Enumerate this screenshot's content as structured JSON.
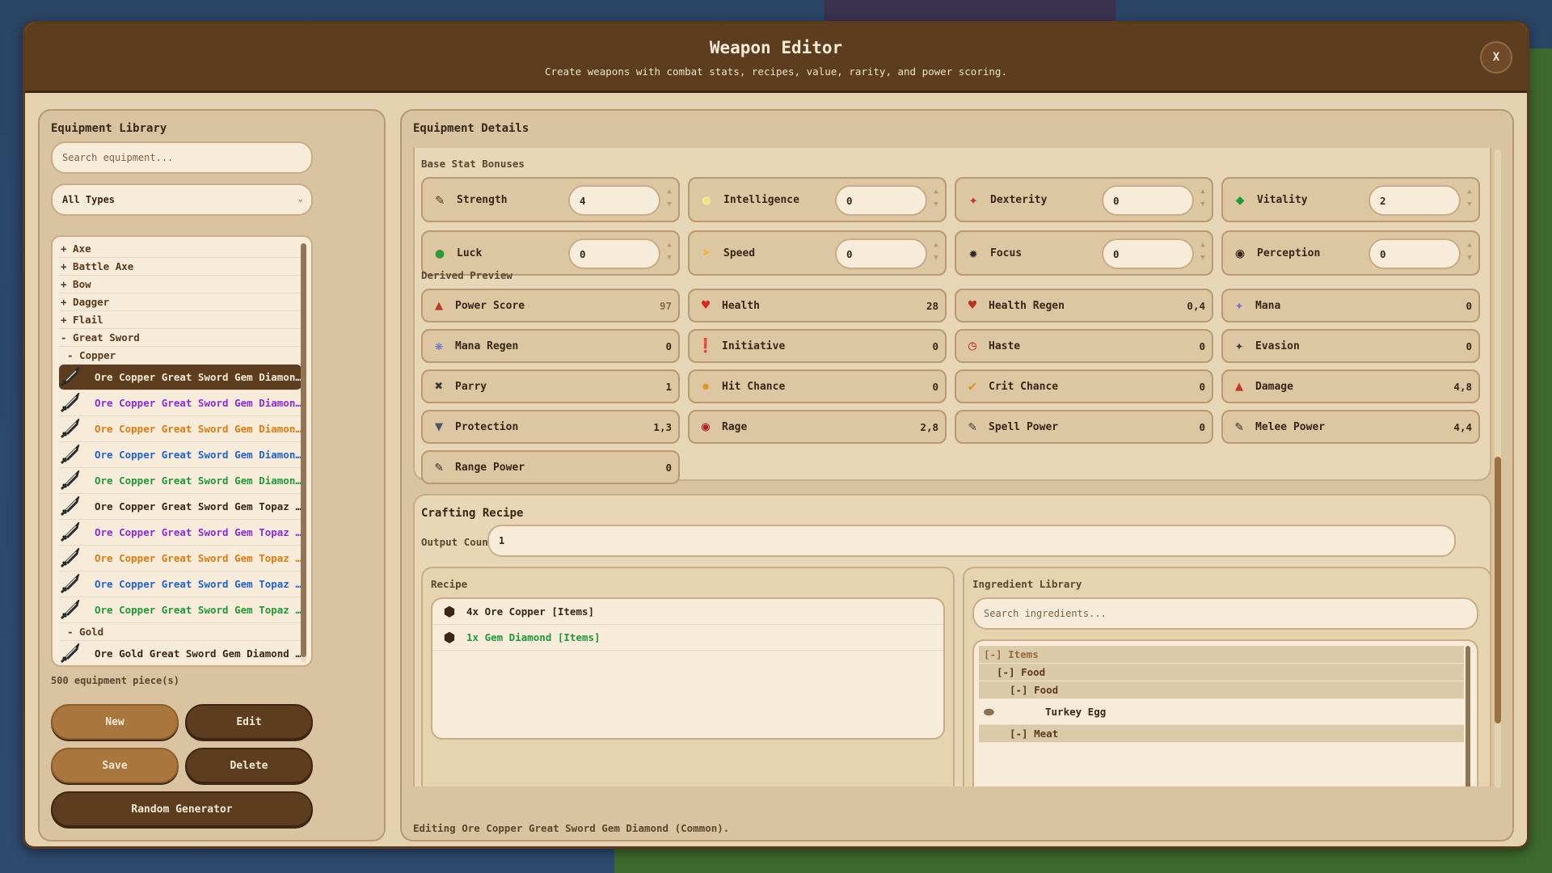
{
  "window": {
    "title": "Weapon Editor",
    "subtitle": "Create weapons with combat stats, recipes, value, rarity, and power scoring.",
    "close_label": "X"
  },
  "library": {
    "title": "Equipment Library",
    "search_placeholder": "Search equipment...",
    "type_filter": "All Types",
    "categories": [
      "+ Axe",
      "+ Battle Axe",
      "+ Bow",
      "+ Dagger",
      "+ Flail",
      "- Great Sword"
    ],
    "subgroup_copper": "- Copper",
    "items": [
      {
        "label": "Ore Copper Great Sword Gem Diamond (Commo...",
        "rarity": "common",
        "selected": true
      },
      {
        "label": "Ore Copper Great Sword Gem Diamond (Epic)  [...",
        "rarity": "epic"
      },
      {
        "label": "Ore Copper Great Sword Gem Diamond (Legend...",
        "rarity": "legend"
      },
      {
        "label": "Ore Copper Great Sword Gem Diamond (Rare)  ...",
        "rarity": "rare"
      },
      {
        "label": "Ore Copper Great Sword Gem Diamond (Uncom...",
        "rarity": "uncom"
      },
      {
        "label": "Ore Copper Great Sword Gem Topaz (Common) ...",
        "rarity": "common"
      },
      {
        "label": "Ore Copper Great Sword Gem Topaz (Epic)  [Epi...",
        "rarity": "epic"
      },
      {
        "label": "Ore Copper Great Sword Gem Topaz (Legendar...",
        "rarity": "legend"
      },
      {
        "label": "Ore Copper Great Sword Gem Topaz (Rare)  [R...",
        "rarity": "rare"
      },
      {
        "label": "Ore Copper Great Sword Gem Topaz (Uncommo...",
        "rarity": "uncom"
      }
    ],
    "subgroup_gold": "- Gold",
    "gold_item": "Ore Gold Great Sword Gem Diamond (Common)  ...",
    "count": "500 equipment piece(s)",
    "buttons": {
      "new": "New",
      "edit": "Edit",
      "save": "Save",
      "delete": "Delete",
      "random": "Random Generator"
    }
  },
  "details": {
    "title": "Equipment Details",
    "base_label": "Base Stat Bonuses",
    "base_stats": [
      {
        "name": "Strength",
        "value": "4",
        "icon": "strength-icon"
      },
      {
        "name": "Intelligence",
        "value": "0",
        "icon": "intelligence-icon"
      },
      {
        "name": "Dexterity",
        "value": "0",
        "icon": "dexterity-icon"
      },
      {
        "name": "Vitality",
        "value": "2",
        "icon": "vitality-icon"
      },
      {
        "name": "Luck",
        "value": "0",
        "icon": "luck-icon"
      },
      {
        "name": "Speed",
        "value": "0",
        "icon": "speed-icon"
      },
      {
        "name": "Focus",
        "value": "0",
        "icon": "focus-icon"
      },
      {
        "name": "Perception",
        "value": "0",
        "icon": "perception-icon"
      }
    ],
    "derived_label": "Derived Preview",
    "derived": [
      {
        "name": "Power Score",
        "value": "97",
        "icon": "power-score-icon"
      },
      {
        "name": "Health",
        "value": "28",
        "icon": "health-icon"
      },
      {
        "name": "Health Regen",
        "value": "0,4",
        "icon": "health-regen-icon"
      },
      {
        "name": "Mana",
        "value": "0",
        "icon": "mana-icon"
      },
      {
        "name": "Mana Regen",
        "value": "0",
        "icon": "mana-regen-icon"
      },
      {
        "name": "Initiative",
        "value": "0",
        "icon": "initiative-icon"
      },
      {
        "name": "Haste",
        "value": "0",
        "icon": "haste-icon"
      },
      {
        "name": "Evasion",
        "value": "0",
        "icon": "evasion-icon"
      },
      {
        "name": "Parry",
        "value": "1",
        "icon": "parry-icon"
      },
      {
        "name": "Hit Chance",
        "value": "0",
        "icon": "hit-chance-icon"
      },
      {
        "name": "Crit Chance",
        "value": "0",
        "icon": "crit-chance-icon"
      },
      {
        "name": "Damage",
        "value": "4,8",
        "icon": "damage-icon"
      },
      {
        "name": "Protection",
        "value": "1,3",
        "icon": "protection-icon"
      },
      {
        "name": "Rage",
        "value": "2,8",
        "icon": "rage-icon"
      },
      {
        "name": "Spell Power",
        "value": "0",
        "icon": "spell-power-icon"
      },
      {
        "name": "Melee Power",
        "value": "4,4",
        "icon": "melee-power-icon"
      },
      {
        "name": "Range Power",
        "value": "0",
        "icon": "range-power-icon"
      }
    ],
    "crafting": {
      "title": "Crafting Recipe",
      "output_label": "Output Count",
      "output_value": "1",
      "recipe_label": "Recipe",
      "recipe_items": [
        {
          "label": "4x Ore Copper  [Items]",
          "color": "#3a2616"
        },
        {
          "label": "1x Gem Diamond  [Items]",
          "color": "#1f9a3a"
        }
      ],
      "ingredient_label": "Ingredient Library",
      "ingredient_placeholder": "Search ingredients...",
      "ingredient_tree": {
        "items": "[-] Items",
        "food_group": "[-] Food",
        "food_sub": "[-] Food",
        "turkey_egg": "Turkey Egg",
        "meat": "[-] Meat"
      }
    },
    "status": "Editing Ore Copper Great Sword Gem Diamond (Common)."
  }
}
